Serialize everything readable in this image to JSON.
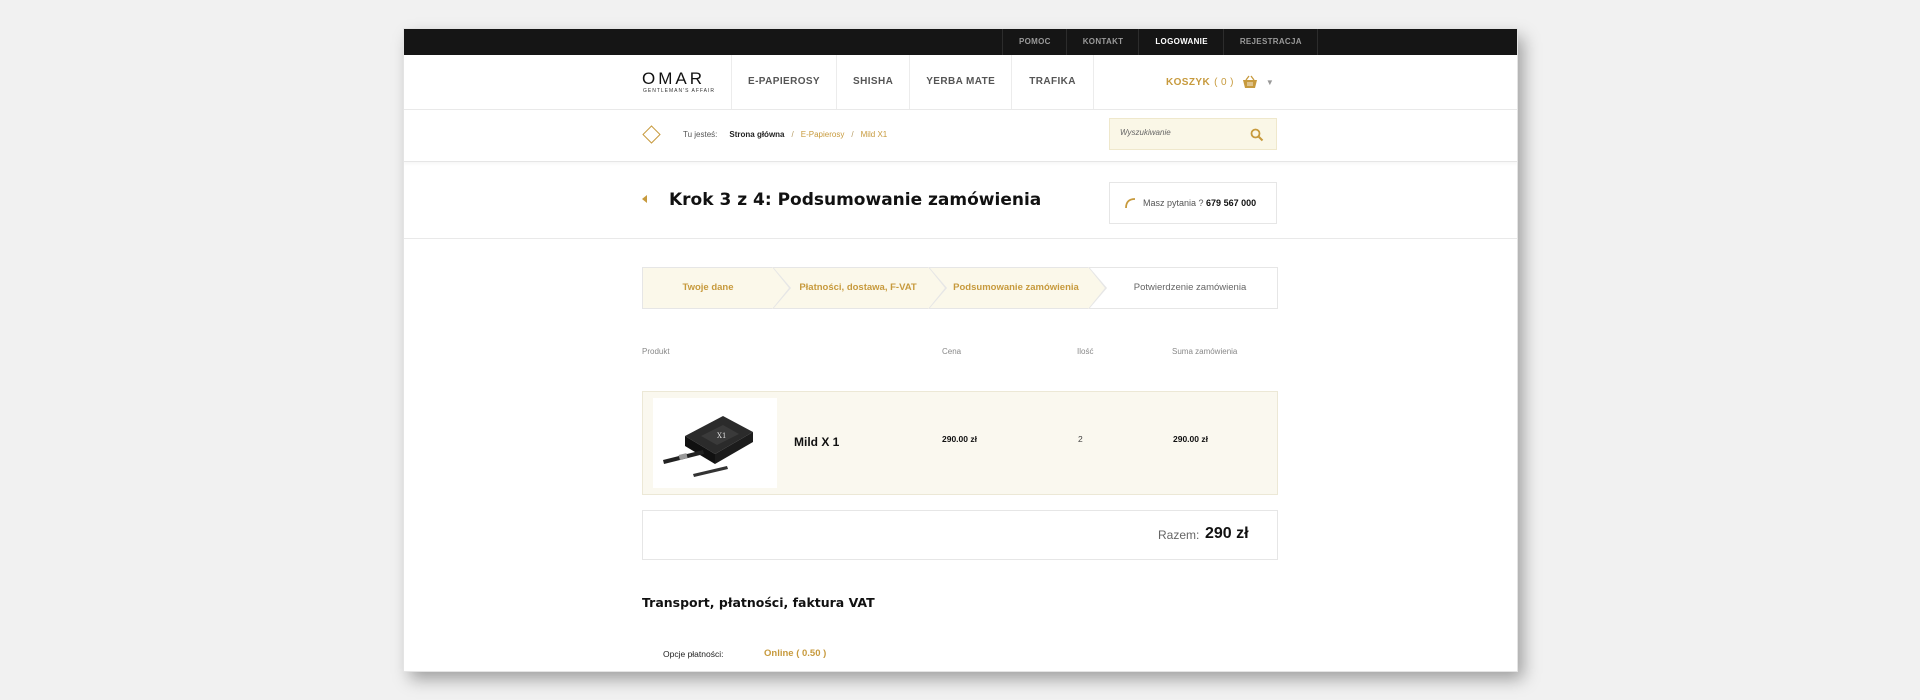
{
  "topnav": [
    {
      "label": "POMOC",
      "active": false
    },
    {
      "label": "KONTAKT",
      "active": false
    },
    {
      "label": "LOGOWANIE",
      "active": true
    },
    {
      "label": "REJESTRACJA",
      "active": false
    }
  ],
  "logo": {
    "name": "OMAR",
    "tagline": "GENTLEMAN'S AFFAIR"
  },
  "mainnav": [
    "E-PAPIEROSY",
    "SHISHA",
    "YERBA MATE",
    "TRAFIKA"
  ],
  "cart": {
    "label": "KOSZYK",
    "count": "( 0 )"
  },
  "breadcrumb": {
    "prefix": "Tu jesteś:",
    "items": [
      "Strona główna",
      "E-Papierosy",
      "Mild X1"
    ]
  },
  "search": {
    "placeholder": "Wyszukiwanie"
  },
  "page_title": "Krok 3 z 4: Podsumowanie zamówienia",
  "question": {
    "text": "Masz pytania ?",
    "phone": "679 567 000"
  },
  "steps": [
    {
      "label": "Twoje dane",
      "state": "done"
    },
    {
      "label": "Płatności, dostawa, F-VAT",
      "state": "done"
    },
    {
      "label": "Podsumowanie zamówienia",
      "state": "done"
    },
    {
      "label": "Potwierdzenie zamówienia",
      "state": "todo"
    }
  ],
  "table": {
    "headers": [
      "Produkt",
      "Cena",
      "Ilość",
      "Suma zamówienia"
    ],
    "rows": [
      {
        "name": "Mild X 1",
        "price": "290.00 zł",
        "qty": "2",
        "total": "290.00 zł"
      }
    ]
  },
  "summary": {
    "label": "Razem:",
    "value": "290 zł"
  },
  "section_title": "Transport, płatności, faktura VAT",
  "payment": {
    "label": "Opcje płatności:",
    "value": "Online ( 0.50 )"
  },
  "colors": {
    "accent": "#c79a3d",
    "topbar": "#151515",
    "highlight_bg": "#fbf8ea"
  }
}
